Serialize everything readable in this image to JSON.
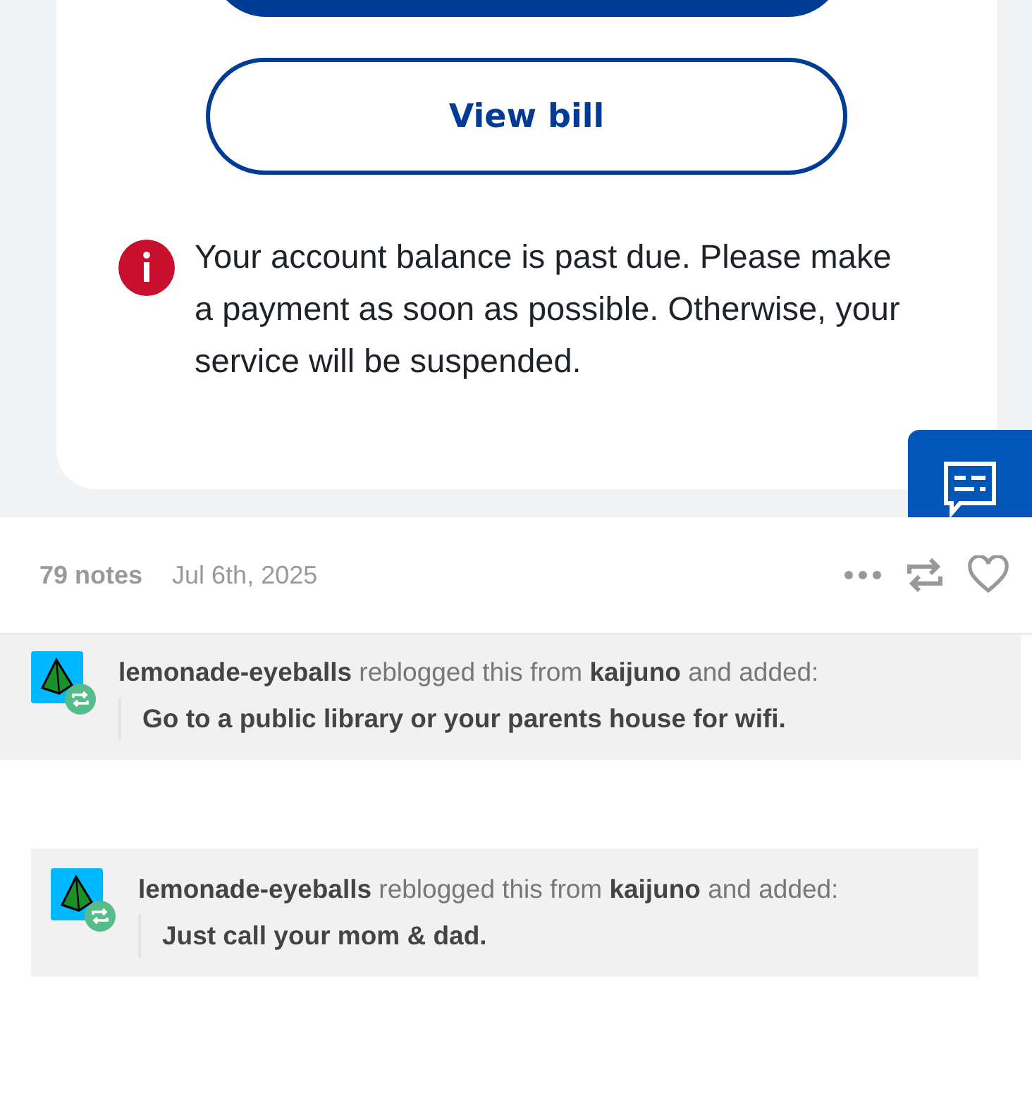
{
  "billing_card": {
    "view_bill_button": "View bill",
    "notice": "Your account balance is past due. Please make a payment as soon as possible. Otherwise, your service will be suspended."
  },
  "post_footer": {
    "notes": "79 notes",
    "date": "Jul 6th, 2025"
  },
  "reblogs": [
    {
      "header": "**lemonade-eyeballs** reblogged this from **kaijuno** and added:",
      "comment": "Go to a public library or your parents house for wifi."
    },
    {
      "header": "**lemonade-eyeballs** reblogged this from **kaijuno** and added:",
      "comment": "Just call your mom & dad."
    }
  ]
}
